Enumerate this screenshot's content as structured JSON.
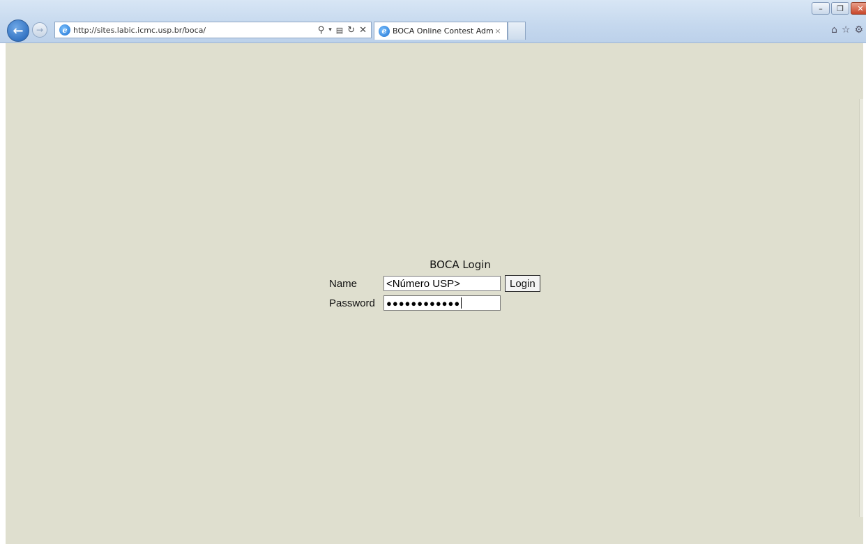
{
  "browser": {
    "address_url": "http://sites.labic.icmc.usp.br/boca/",
    "tab_title": "BOCA Online Contest Adm...",
    "tab_close": "×",
    "tool_icons": [
      "search-icon",
      "compat-icon",
      "refresh-icon",
      "stop-icon"
    ],
    "window_controls": [
      "minimize-icon",
      "restore-icon",
      "close-icon"
    ],
    "right_icons": [
      "home-icon",
      "favorites-icon",
      "settings-icon"
    ]
  },
  "page": {
    "background_color": "#dfdfcf",
    "login": {
      "title": "BOCA Login",
      "name_label": "Name",
      "name_value": "<Número USP>",
      "password_label": "Password",
      "password_mask": "●●●●●●●●●●●●",
      "login_button": "Login"
    }
  }
}
